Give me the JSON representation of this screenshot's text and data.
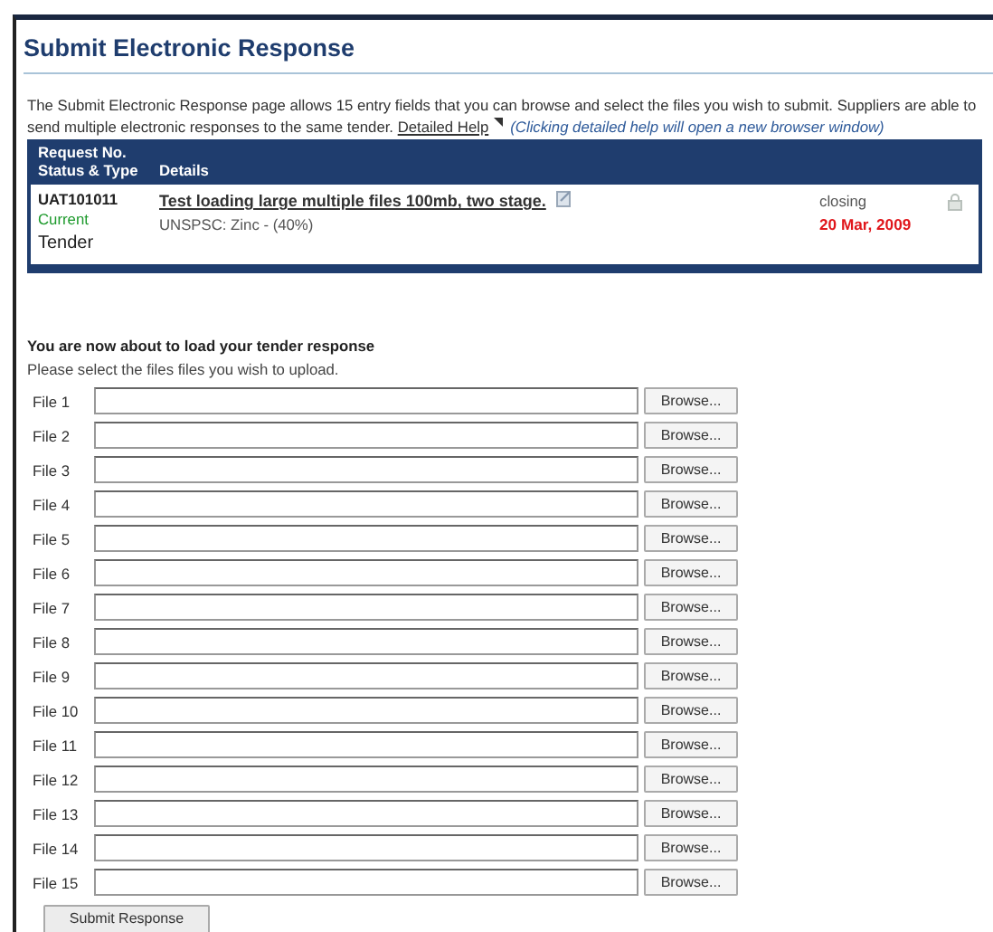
{
  "title": "Submit Electronic Response",
  "intro": {
    "text": "The Submit Electronic Response page allows 15 entry fields that you can browse and select the files you wish to submit. Suppliers are able to send multiple electronic responses to the same tender.",
    "help_link": "Detailed Help",
    "note": "(Clicking detailed help will open a new browser window)"
  },
  "request_table": {
    "headers": [
      "Request No.",
      "Status & Type",
      "Details"
    ],
    "row": {
      "request_no": "UAT101011",
      "status": "Current",
      "type": "Tender",
      "title": "Test loading large multiple files 100mb, two stage.",
      "classification": "UNSPSC: Zinc - (40%)",
      "closing_label": "closing",
      "closing_date": "20 Mar, 2009"
    }
  },
  "upload": {
    "heading": "You are now about to load your tender response",
    "instruction": "Please select the files files you wish to upload.",
    "files": [
      {
        "label": "File 1",
        "button": "Browse..."
      },
      {
        "label": "File 2",
        "button": "Browse..."
      },
      {
        "label": "File 3",
        "button": "Browse..."
      },
      {
        "label": "File 4",
        "button": "Browse..."
      },
      {
        "label": "File 5",
        "button": "Browse..."
      },
      {
        "label": "File 6",
        "button": "Browse..."
      },
      {
        "label": "File 7",
        "button": "Browse..."
      },
      {
        "label": "File 8",
        "button": "Browse..."
      },
      {
        "label": "File 9",
        "button": "Browse..."
      },
      {
        "label": "File 10",
        "button": "Browse..."
      },
      {
        "label": "File 11",
        "button": "Browse..."
      },
      {
        "label": "File 12",
        "button": "Browse..."
      },
      {
        "label": "File 13",
        "button": "Browse..."
      },
      {
        "label": "File 14",
        "button": "Browse..."
      },
      {
        "label": "File 15",
        "button": "Browse..."
      }
    ],
    "submit": "Submit Response"
  }
}
